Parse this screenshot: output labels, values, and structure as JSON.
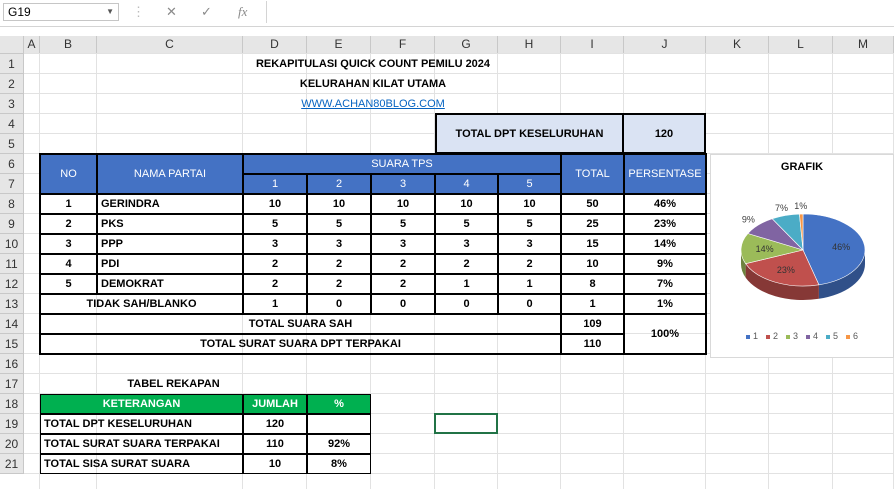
{
  "formula_bar": {
    "cell_ref": "G19",
    "cancel_icon": "✕",
    "enter_icon": "✓",
    "fx_icon": "fx",
    "formula": ""
  },
  "columns": [
    "A",
    "B",
    "C",
    "D",
    "E",
    "F",
    "G",
    "H",
    "I",
    "J",
    "K",
    "L",
    "M"
  ],
  "rows": [
    "1",
    "2",
    "3",
    "4",
    "5",
    "6",
    "7",
    "8",
    "9",
    "10",
    "11",
    "12",
    "13",
    "14",
    "15",
    "16",
    "17",
    "18",
    "19",
    "20",
    "21"
  ],
  "header": {
    "title": "REKAPITULASI QUICK COUNT PEMILU 2024",
    "subtitle": "KELURAHAN KILAT UTAMA",
    "website": "WWW.ACHAN80BLOG.COM",
    "dpt_label": "TOTAL DPT KESELURUHAN",
    "dpt_value": "120"
  },
  "table": {
    "col_no": "NO",
    "col_party": "NAMA PARTAI",
    "col_tps": "SUARA TPS",
    "tps": [
      "1",
      "2",
      "3",
      "4",
      "5"
    ],
    "col_total": "TOTAL",
    "col_pct": "PERSENTASE",
    "rows": [
      {
        "no": "1",
        "party": "GERINDRA",
        "v": [
          "10",
          "10",
          "10",
          "10",
          "10"
        ],
        "total": "50",
        "pct": "46%"
      },
      {
        "no": "2",
        "party": "PKS",
        "v": [
          "5",
          "5",
          "5",
          "5",
          "5"
        ],
        "total": "25",
        "pct": "23%"
      },
      {
        "no": "3",
        "party": "PPP",
        "v": [
          "3",
          "3",
          "3",
          "3",
          "3"
        ],
        "total": "15",
        "pct": "14%"
      },
      {
        "no": "4",
        "party": "PDI",
        "v": [
          "2",
          "2",
          "2",
          "2",
          "2"
        ],
        "total": "10",
        "pct": "9%"
      },
      {
        "no": "5",
        "party": "DEMOKRAT",
        "v": [
          "2",
          "2",
          "2",
          "1",
          "1"
        ],
        "total": "8",
        "pct": "7%"
      }
    ],
    "invalid": {
      "label": "TIDAK SAH/BLANKO",
      "v": [
        "1",
        "0",
        "0",
        "0",
        "0"
      ],
      "total": "1",
      "pct": "1%"
    },
    "total_valid_label": "TOTAL SUARA SAH",
    "total_valid": "109",
    "total_used_label": "TOTAL SURAT SUARA DPT TERPAKAI",
    "total_used": "110",
    "total_pct": "100%"
  },
  "recap": {
    "title": "TABEL REKAPAN",
    "headers": [
      "KETERANGAN",
      "JUMLAH",
      "%"
    ],
    "rows": [
      {
        "label": "TOTAL DPT KESELURUHAN",
        "value": "120",
        "pct": ""
      },
      {
        "label": "TOTAL SURAT SUARA TERPAKAI",
        "value": "110",
        "pct": "92%"
      },
      {
        "label": "TOTAL SISA SURAT SUARA",
        "value": "10",
        "pct": "8%"
      }
    ]
  },
  "chart_data": {
    "type": "pie",
    "title": "GRAFIK",
    "categories": [
      "1",
      "2",
      "3",
      "4",
      "5",
      "6"
    ],
    "values": [
      50,
      25,
      15,
      10,
      8,
      1
    ],
    "data_labels": [
      "46%",
      "23%",
      "14%",
      "9%",
      "7%",
      "1%"
    ],
    "colors": [
      "#4472c4",
      "#c0504d",
      "#9bbb59",
      "#8064a2",
      "#4bacc6",
      "#f79646"
    ],
    "legend_position": "bottom"
  }
}
